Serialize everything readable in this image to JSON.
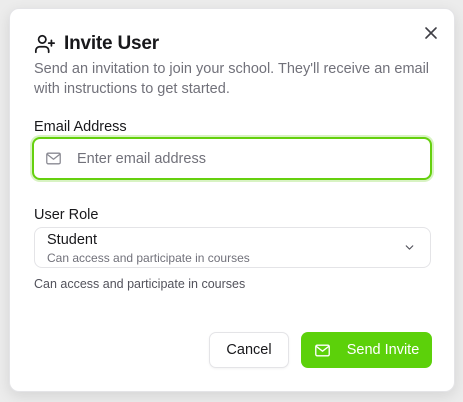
{
  "dialog": {
    "title": "Invite User",
    "description": "Send an invitation to join your school. They'll receive an email with instructions to get started.",
    "close_icon": "close-icon",
    "title_icon": "user-plus-icon"
  },
  "email": {
    "label": "Email Address",
    "placeholder": "Enter email address",
    "value": "",
    "icon": "mail-icon"
  },
  "role": {
    "label": "User Role",
    "selected_title": "Student",
    "selected_description": "Can access and participate in courses",
    "helper_text": "Can access and participate in courses",
    "icon": "chevron-down-icon"
  },
  "actions": {
    "cancel_label": "Cancel",
    "send_label": "Send Invite",
    "send_icon": "mail-icon"
  },
  "colors": {
    "accent": "#5cd10a",
    "focus_ring": "#65d00e",
    "text": "#18181b",
    "muted": "#71717a",
    "border": "#e4e4e7"
  }
}
